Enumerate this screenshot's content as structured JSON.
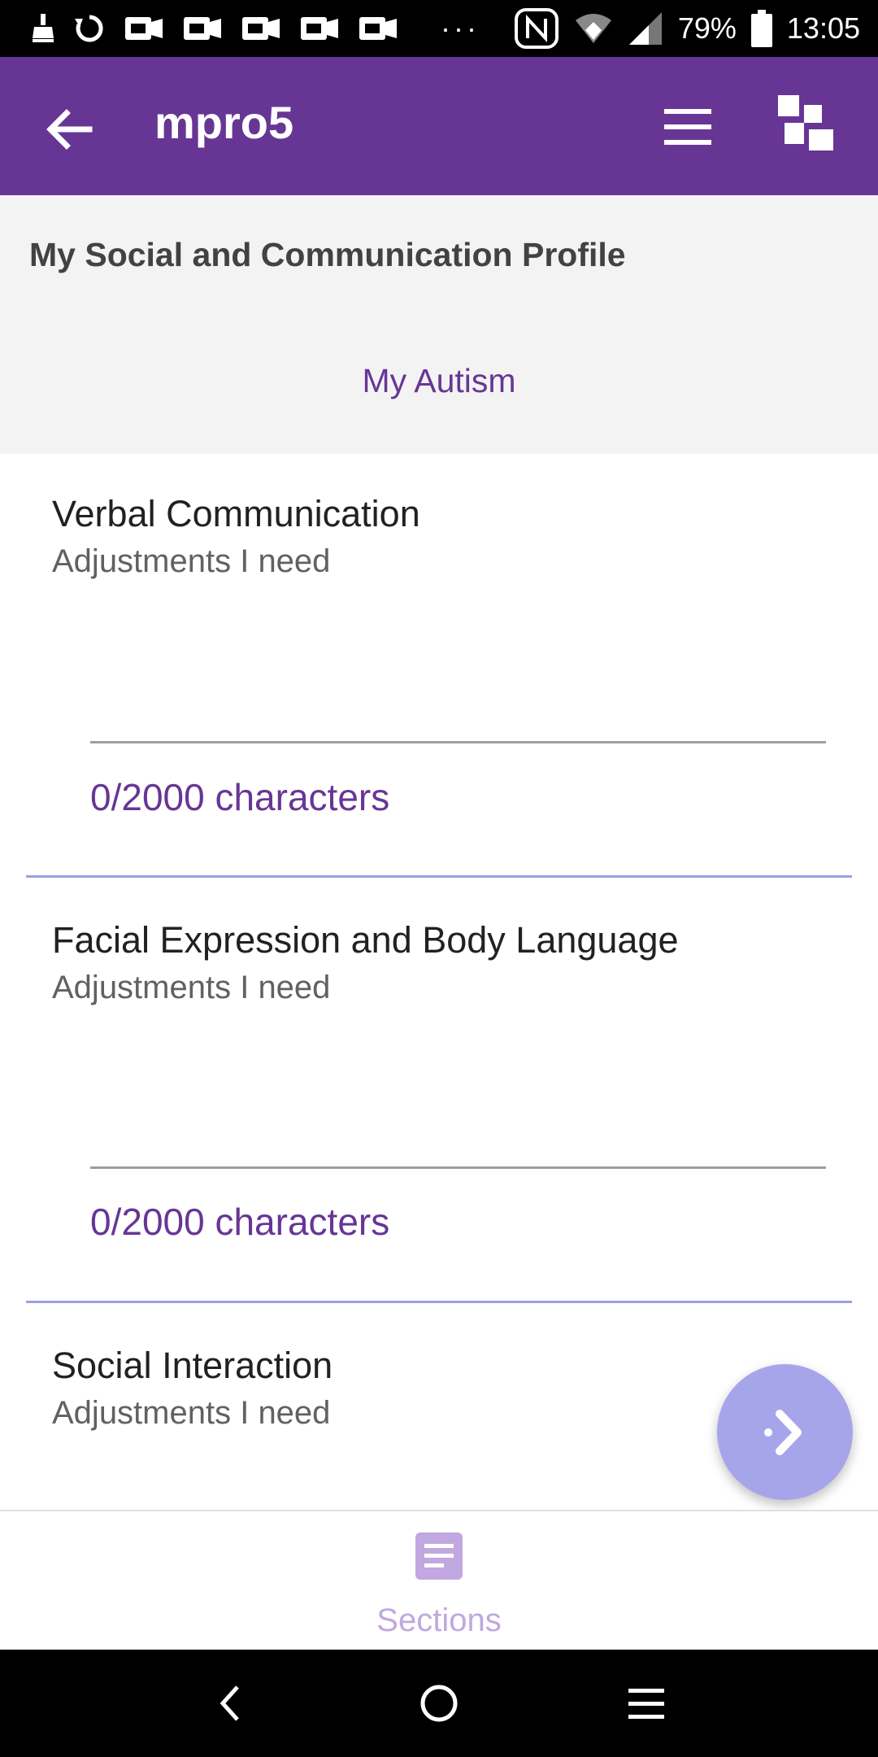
{
  "status_bar": {
    "battery": "79%",
    "time": "13:05",
    "overflow": "···",
    "icons": [
      "broom-icon",
      "sync-icon",
      "notification-icon",
      "notification-icon",
      "notification-icon",
      "notification-icon",
      "notification-icon",
      "nfc-icon",
      "wifi-icon",
      "signal-icon",
      "battery-icon"
    ]
  },
  "app_bar": {
    "title": "mpro5",
    "icons": [
      "back-arrow-icon",
      "hamburger-menu-icon",
      "dashboard-grid-icon"
    ]
  },
  "header": {
    "profile_title": "My Social and Communication Profile",
    "section_tab": "My Autism"
  },
  "fields": [
    {
      "title": "Verbal Communication",
      "subtitle": "Adjustments I need",
      "value": "",
      "char_count": "0/2000 characters"
    },
    {
      "title": "Facial Expression and Body Language",
      "subtitle": "Adjustments I need",
      "value": "",
      "char_count": "0/2000 characters"
    },
    {
      "title": "Social Interaction",
      "subtitle": "Adjustments I need"
    }
  ],
  "bottom_bar": {
    "sections_label": "Sections"
  },
  "colors": {
    "primary": "#673695",
    "fab": "#a7a5ea",
    "divider": "#9e9ee0",
    "sections_label": "#c1a8e0"
  }
}
